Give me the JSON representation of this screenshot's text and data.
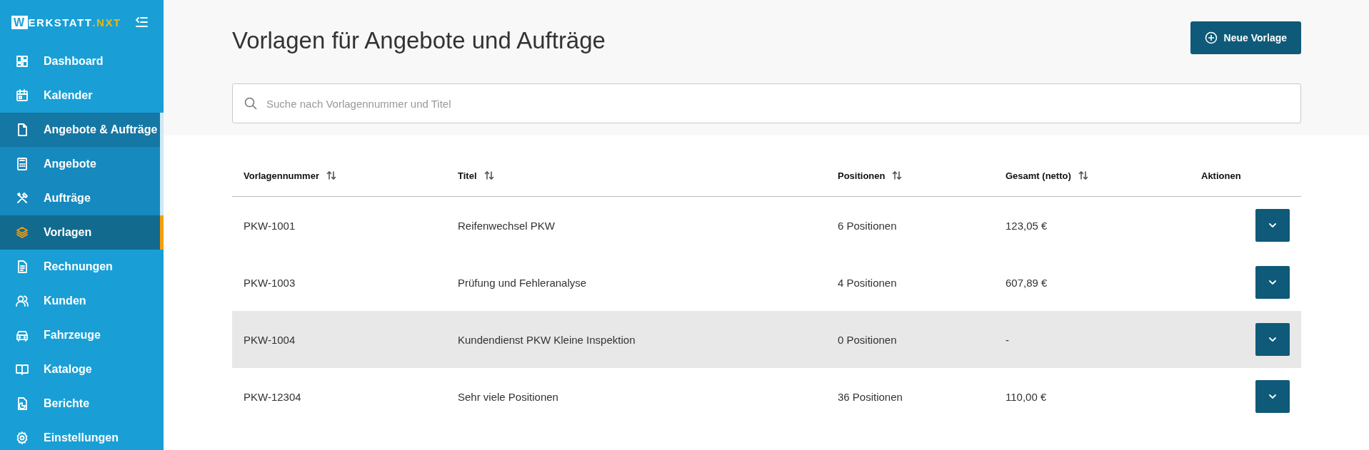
{
  "sidebar": {
    "logo": {
      "initial": "W",
      "name": "ERKSTATT",
      "suffix": ".NXT"
    },
    "items": [
      {
        "label": "Dashboard",
        "selected": false
      },
      {
        "label": "Kalender",
        "selected": false
      },
      {
        "label": "Angebote & Aufträge",
        "selected": false,
        "expanded": true,
        "children": [
          {
            "label": "Angebote",
            "selected": false
          },
          {
            "label": "Aufträge",
            "selected": false
          },
          {
            "label": "Vorlagen",
            "selected": true
          }
        ]
      },
      {
        "label": "Rechnungen",
        "selected": false
      },
      {
        "label": "Kunden",
        "selected": false
      },
      {
        "label": "Fahrzeuge",
        "selected": false
      },
      {
        "label": "Kataloge",
        "selected": false
      },
      {
        "label": "Berichte",
        "selected": false
      },
      {
        "label": "Einstellungen",
        "selected": false
      }
    ]
  },
  "header": {
    "title": "Vorlagen für Angebote und Aufträge",
    "new_button": "Neue Vorlage"
  },
  "search": {
    "placeholder": "Suche nach Vorlagennummer und Titel"
  },
  "table": {
    "columns": [
      {
        "label": "Vorlagennummer",
        "sortable": true
      },
      {
        "label": "Titel",
        "sortable": true
      },
      {
        "label": "Positionen",
        "sortable": true
      },
      {
        "label": "Gesamt (netto)",
        "sortable": true
      },
      {
        "label": "Aktionen",
        "sortable": false
      }
    ],
    "rows": [
      {
        "number": "PKW-1001",
        "title": "Reifenwechsel PKW",
        "positions": "6 Positionen",
        "total": "123,05 €",
        "hovered": false
      },
      {
        "number": "PKW-1003",
        "title": "Prüfung und Fehleranalyse",
        "positions": "4 Positionen",
        "total": "607,89 €",
        "hovered": false
      },
      {
        "number": "PKW-1004",
        "title": "Kundendienst PKW Kleine Inspektion",
        "positions": "0 Positionen",
        "total": "-",
        "hovered": true
      },
      {
        "number": "PKW-12304",
        "title": "Sehr viele Positionen",
        "positions": "36 Positionen",
        "total": "110,00 €",
        "hovered": false
      }
    ]
  }
}
